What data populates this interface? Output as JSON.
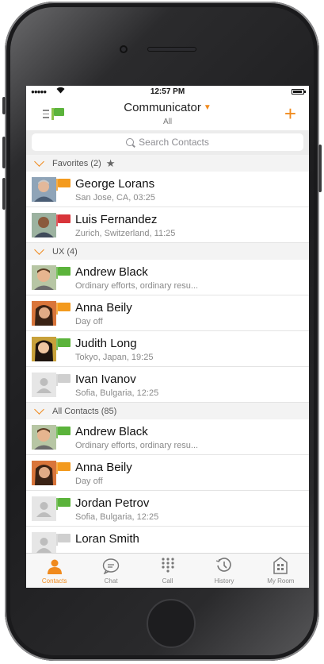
{
  "status_bar": {
    "time": "12:57 PM"
  },
  "nav": {
    "title": "Communicator",
    "subtitle": "All",
    "add_label": "+"
  },
  "search": {
    "placeholder": "Search Contacts"
  },
  "sections": {
    "favorites": {
      "label": "Favorites (2)"
    },
    "ux": {
      "label": "UX (4)"
    },
    "all_contacts": {
      "label": "All Contacts (85)"
    }
  },
  "favorites": [
    {
      "name": "George Lorans",
      "detail": "San Jose, CA, 03:25",
      "presence": "orange"
    },
    {
      "name": "Luis Fernandez",
      "detail": "Zurich, Switzerland, 11:25",
      "presence": "red"
    }
  ],
  "ux": [
    {
      "name": "Andrew Black",
      "detail": "Ordinary efforts, ordinary resu...",
      "presence": "green"
    },
    {
      "name": "Anna Beily",
      "detail": "Day off",
      "presence": "orange"
    },
    {
      "name": "Judith Long",
      "detail": "Tokyo, Japan, 19:25",
      "presence": "green"
    },
    {
      "name": "Ivan Ivanov",
      "detail": "Sofia, Bulgaria, 12:25",
      "presence": "gray"
    }
  ],
  "all_contacts": [
    {
      "name": "Andrew Black",
      "detail": "Ordinary efforts, ordinary resu...",
      "presence": "green"
    },
    {
      "name": "Anna Beily",
      "detail": "Day off",
      "presence": "orange"
    },
    {
      "name": "Jordan Petrov",
      "detail": "Sofia, Bulgaria, 12:25",
      "presence": "green"
    },
    {
      "name": "Loran Smith",
      "detail": "",
      "presence": "gray"
    }
  ],
  "tabs": [
    {
      "label": "Contacts",
      "icon": "person-icon",
      "active": true
    },
    {
      "label": "Chat",
      "icon": "chat-bubble-icon",
      "active": false
    },
    {
      "label": "Call",
      "icon": "dialpad-icon",
      "active": false
    },
    {
      "label": "History",
      "icon": "clock-history-icon",
      "active": false
    },
    {
      "label": "My Room",
      "icon": "room-icon",
      "active": false
    }
  ],
  "colors": {
    "accent": "#f08a1d",
    "presence_green": "#5bb33b",
    "presence_orange": "#f39a1e",
    "presence_red": "#d8343a",
    "presence_gray": "#cfcfcf"
  }
}
